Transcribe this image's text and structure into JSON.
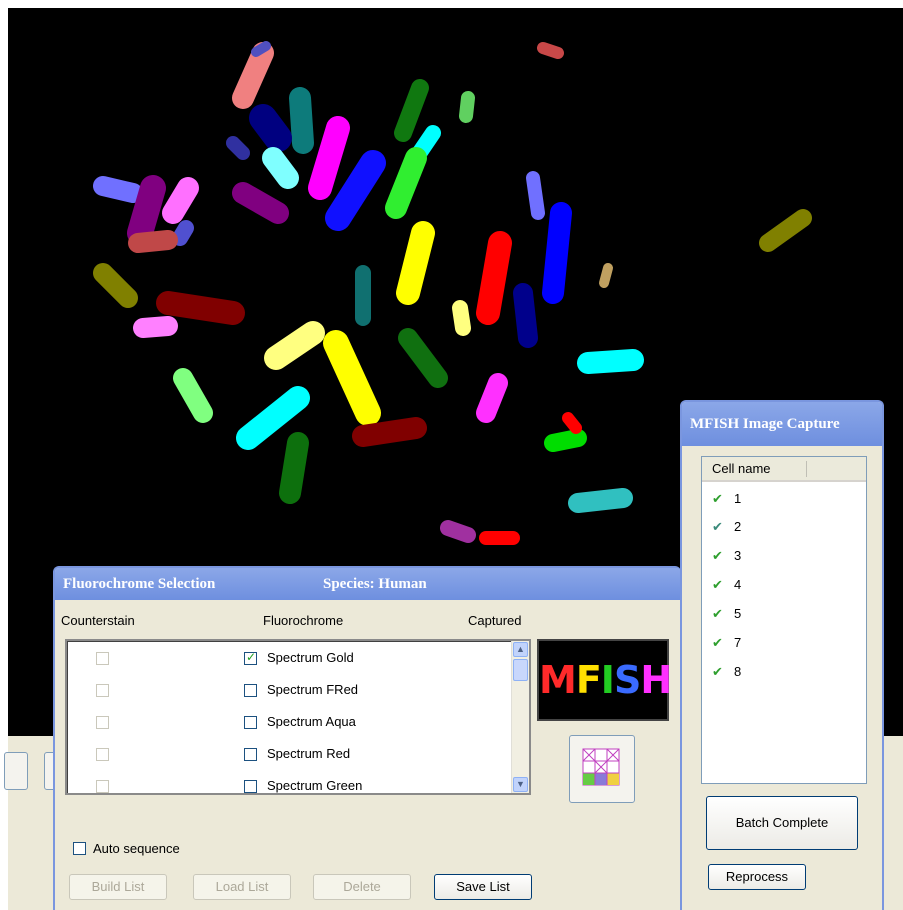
{
  "fluorochrome_panel": {
    "title": "Fluorochrome Selection",
    "species": "Species: Human",
    "columns": {
      "counterstain": "Counterstain",
      "fluorochrome": "Fluorochrome",
      "captured": "Captured"
    },
    "rows": [
      {
        "label": "Spectrum Gold",
        "checked": true
      },
      {
        "label": "Spectrum FRed",
        "checked": false
      },
      {
        "label": "Spectrum Aqua",
        "checked": false
      },
      {
        "label": "Spectrum Red",
        "checked": false
      },
      {
        "label": "Spectrum Green",
        "checked": false
      }
    ],
    "auto_sequence_label": "Auto sequence",
    "buttons": {
      "build_list": "Build List",
      "load_list": "Load List",
      "delete": "Delete",
      "save_list": "Save List"
    },
    "logo_text": "MFISH",
    "logo_colors": [
      "#ff2a2a",
      "#ffe000",
      "#22cc22",
      "#3a6bff",
      "#ff30ff"
    ]
  },
  "capture_panel": {
    "title": "MFISH Image Capture",
    "column_header": "Cell name",
    "cells": [
      "1",
      "2",
      "3",
      "4",
      "5",
      "7",
      "8"
    ],
    "buttons": {
      "batch_complete": "Batch Complete",
      "reprocess": "Reprocess"
    }
  },
  "icons": [
    "check-icon",
    "scroll-up-icon",
    "scroll-down-icon",
    "grid-icon",
    "mfish-logo"
  ],
  "colors": {
    "title_bar": "#7393e3",
    "panel_bg": "#ece9d8",
    "image_bg": "#000000"
  }
}
